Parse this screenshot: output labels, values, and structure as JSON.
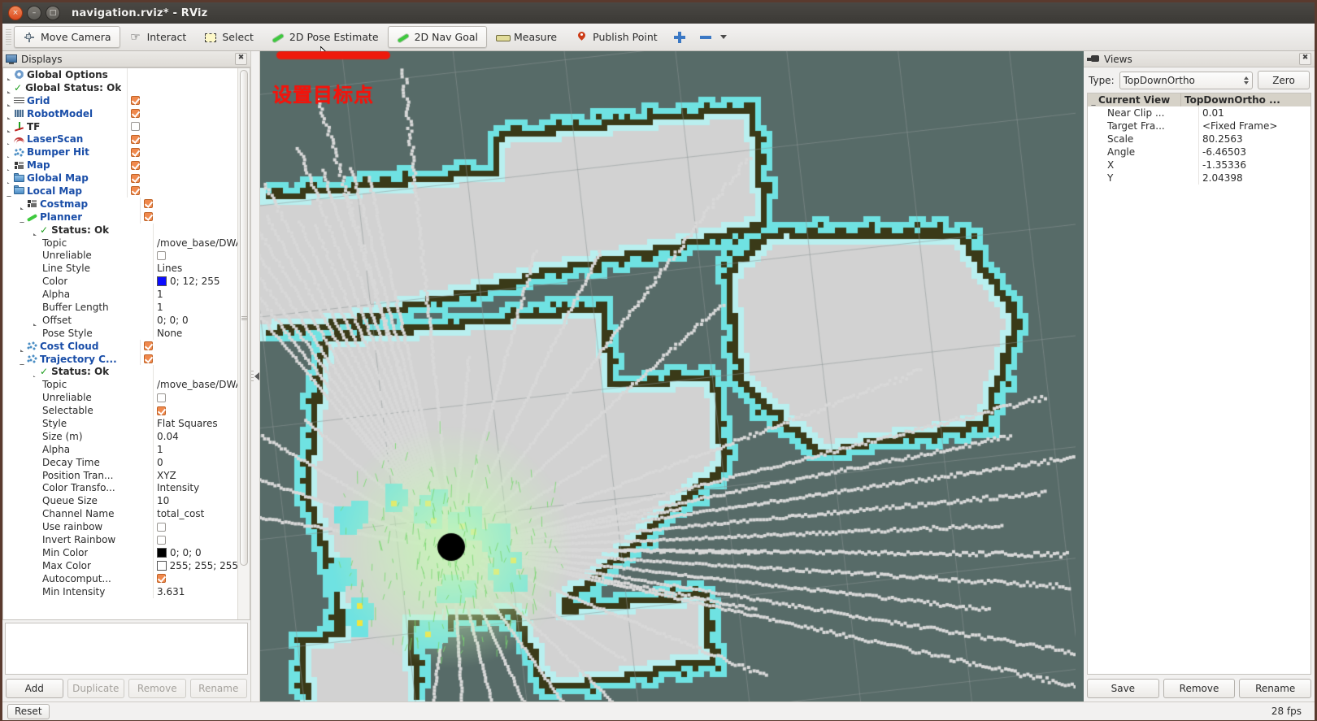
{
  "window": {
    "title": "navigation.rviz* - RViz",
    "close": "×",
    "minimize": "–",
    "maximize": "□"
  },
  "toolbar": {
    "items": [
      {
        "label": "Move Camera",
        "icon": "move-camera-icon",
        "active": true
      },
      {
        "label": "Interact",
        "icon": "hand-icon",
        "active": false
      },
      {
        "label": "Select",
        "icon": "select-rect-icon",
        "active": false
      },
      {
        "label": "2D Pose Estimate",
        "icon": "green-arrow-icon",
        "active": false
      },
      {
        "label": "2D Nav Goal",
        "icon": "green-arrow-icon",
        "active": true
      },
      {
        "label": "Measure",
        "icon": "ruler-icon",
        "active": false
      },
      {
        "label": "Publish Point",
        "icon": "map-pin-icon",
        "active": false
      }
    ],
    "add_tool_label": "",
    "remove_tool_label": ""
  },
  "displays_panel": {
    "title": "Displays",
    "close": "✖",
    "rows": [
      {
        "indent": 0,
        "twisty": "r",
        "icon": "mi-gear",
        "name": "Global Options",
        "style": "bold",
        "check": null,
        "value": ""
      },
      {
        "indent": 0,
        "twisty": "r",
        "icon": "tick",
        "name": "Global Status: Ok",
        "style": "bold",
        "check": null,
        "value": ""
      },
      {
        "indent": 0,
        "twisty": "r",
        "icon": "mi-grid",
        "name": "Grid",
        "style": "blue",
        "check": true,
        "value": ""
      },
      {
        "indent": 0,
        "twisty": "r",
        "icon": "mi-robot",
        "name": "RobotModel",
        "style": "blue",
        "check": true,
        "value": ""
      },
      {
        "indent": 0,
        "twisty": "r",
        "icon": "mi-tf",
        "name": "TF",
        "style": "bold",
        "check": false,
        "value": ""
      },
      {
        "indent": 0,
        "twisty": "r",
        "icon": "mi-laser",
        "name": "LaserScan",
        "style": "blue",
        "check": true,
        "value": ""
      },
      {
        "indent": 0,
        "twisty": "r",
        "icon": "mi-cloud",
        "name": "Bumper Hit",
        "style": "blue",
        "check": true,
        "value": ""
      },
      {
        "indent": 0,
        "twisty": "r",
        "icon": "mi-map",
        "name": "Map",
        "style": "blue",
        "check": true,
        "value": ""
      },
      {
        "indent": 0,
        "twisty": "r",
        "icon": "mi-folder",
        "name": "Global Map",
        "style": "blue",
        "check": true,
        "value": ""
      },
      {
        "indent": 0,
        "twisty": "d",
        "icon": "mi-folder",
        "name": "Local Map",
        "style": "blue",
        "check": true,
        "value": ""
      },
      {
        "indent": 1,
        "twisty": "r",
        "icon": "mi-map",
        "name": "Costmap",
        "style": "blue",
        "check": true,
        "value": ""
      },
      {
        "indent": 1,
        "twisty": "d",
        "icon": "mi-path",
        "name": "Planner",
        "style": "blue",
        "check": true,
        "value": ""
      },
      {
        "indent": 2,
        "twisty": "r",
        "icon": "tick",
        "name": "Status: Ok",
        "style": "bold",
        "check": null,
        "value": ""
      },
      {
        "indent": 2,
        "twisty": "none",
        "icon": "none",
        "name": "Topic",
        "style": "plain",
        "check": null,
        "value": "/move_base/DWAPlan..."
      },
      {
        "indent": 2,
        "twisty": "none",
        "icon": "none",
        "name": "Unreliable",
        "style": "plain",
        "check": false,
        "value": ""
      },
      {
        "indent": 2,
        "twisty": "none",
        "icon": "none",
        "name": "Line Style",
        "style": "plain",
        "check": null,
        "value": "Lines"
      },
      {
        "indent": 2,
        "twisty": "none",
        "icon": "none",
        "name": "Color",
        "style": "plain",
        "check": null,
        "value": "0; 12; 255",
        "swatch": "#0b0cff"
      },
      {
        "indent": 2,
        "twisty": "none",
        "icon": "none",
        "name": "Alpha",
        "style": "plain",
        "check": null,
        "value": "1"
      },
      {
        "indent": 2,
        "twisty": "none",
        "icon": "none",
        "name": "Buffer Length",
        "style": "plain",
        "check": null,
        "value": "1"
      },
      {
        "indent": 2,
        "twisty": "r",
        "icon": "none",
        "name": "Offset",
        "style": "plain",
        "check": null,
        "value": "0; 0; 0"
      },
      {
        "indent": 2,
        "twisty": "none",
        "icon": "none",
        "name": "Pose Style",
        "style": "plain",
        "check": null,
        "value": "None"
      },
      {
        "indent": 1,
        "twisty": "r",
        "icon": "mi-cloud",
        "name": "Cost Cloud",
        "style": "blue",
        "check": true,
        "value": ""
      },
      {
        "indent": 1,
        "twisty": "d",
        "icon": "mi-cloud",
        "name": "Trajectory C...",
        "style": "blue",
        "check": true,
        "value": ""
      },
      {
        "indent": 2,
        "twisty": "r",
        "icon": "tick",
        "name": "Status: Ok",
        "style": "bold",
        "check": null,
        "value": ""
      },
      {
        "indent": 2,
        "twisty": "none",
        "icon": "none",
        "name": "Topic",
        "style": "plain",
        "check": null,
        "value": "/move_base/DWAPlan..."
      },
      {
        "indent": 2,
        "twisty": "none",
        "icon": "none",
        "name": "Unreliable",
        "style": "plain",
        "check": false,
        "value": ""
      },
      {
        "indent": 2,
        "twisty": "none",
        "icon": "none",
        "name": "Selectable",
        "style": "plain",
        "check": true,
        "value": ""
      },
      {
        "indent": 2,
        "twisty": "none",
        "icon": "none",
        "name": "Style",
        "style": "plain",
        "check": null,
        "value": "Flat Squares"
      },
      {
        "indent": 2,
        "twisty": "none",
        "icon": "none",
        "name": "Size (m)",
        "style": "plain",
        "check": null,
        "value": "0.04"
      },
      {
        "indent": 2,
        "twisty": "none",
        "icon": "none",
        "name": "Alpha",
        "style": "plain",
        "check": null,
        "value": "1"
      },
      {
        "indent": 2,
        "twisty": "none",
        "icon": "none",
        "name": "Decay Time",
        "style": "plain",
        "check": null,
        "value": "0"
      },
      {
        "indent": 2,
        "twisty": "none",
        "icon": "none",
        "name": "Position Tran...",
        "style": "plain",
        "check": null,
        "value": "XYZ"
      },
      {
        "indent": 2,
        "twisty": "none",
        "icon": "none",
        "name": "Color Transfo...",
        "style": "plain",
        "check": null,
        "value": "Intensity"
      },
      {
        "indent": 2,
        "twisty": "none",
        "icon": "none",
        "name": "Queue Size",
        "style": "plain",
        "check": null,
        "value": "10"
      },
      {
        "indent": 2,
        "twisty": "none",
        "icon": "none",
        "name": "Channel Name",
        "style": "plain",
        "check": null,
        "value": "total_cost"
      },
      {
        "indent": 2,
        "twisty": "none",
        "icon": "none",
        "name": "Use rainbow",
        "style": "plain",
        "check": false,
        "value": ""
      },
      {
        "indent": 2,
        "twisty": "none",
        "icon": "none",
        "name": "Invert Rainbow",
        "style": "plain",
        "check": false,
        "value": ""
      },
      {
        "indent": 2,
        "twisty": "none",
        "icon": "none",
        "name": "Min Color",
        "style": "plain",
        "check": null,
        "value": "0; 0; 0",
        "swatch": "#000000"
      },
      {
        "indent": 2,
        "twisty": "none",
        "icon": "none",
        "name": "Max Color",
        "style": "plain",
        "check": null,
        "value": "255; 255; 255",
        "swatch": "#ffffff"
      },
      {
        "indent": 2,
        "twisty": "none",
        "icon": "none",
        "name": "Autocomput...",
        "style": "plain",
        "check": true,
        "value": ""
      },
      {
        "indent": 2,
        "twisty": "none",
        "icon": "none",
        "name": "Min Intensity",
        "style": "plain",
        "check": null,
        "value": "3.631"
      }
    ],
    "buttons": {
      "add": "Add",
      "duplicate": "Duplicate",
      "remove": "Remove",
      "rename": "Rename"
    }
  },
  "views_panel": {
    "title": "Views",
    "close": "✖",
    "type_label": "Type:",
    "type_value": "TopDownOrtho",
    "zero_label": "Zero",
    "rows": [
      {
        "name": "Current View",
        "value": "TopDownOrtho ...",
        "header": true,
        "twisty": "d"
      },
      {
        "name": "Near Clip ...",
        "value": "0.01",
        "header": false,
        "twisty": "none"
      },
      {
        "name": "Target Fra...",
        "value": "<Fixed Frame>",
        "header": false,
        "twisty": "none"
      },
      {
        "name": "Scale",
        "value": "80.2563",
        "header": false,
        "twisty": "none"
      },
      {
        "name": "Angle",
        "value": "-6.46503",
        "header": false,
        "twisty": "none"
      },
      {
        "name": "X",
        "value": "-1.35336",
        "header": false,
        "twisty": "none"
      },
      {
        "name": "Y",
        "value": "2.04398",
        "header": false,
        "twisty": "none"
      }
    ],
    "buttons": {
      "save": "Save",
      "remove": "Remove",
      "rename": "Rename"
    }
  },
  "viewport": {
    "annotation_text": "设置目标点",
    "annotation_color": "#f2140c",
    "background_color": "#576b68",
    "free_space_color": "#d2d2d2",
    "obstacle_color": "#3a3a18",
    "inflation_color": "#6fe2e2",
    "cost_cloud_color": "#c8f0b8",
    "robot_color": "#000000"
  },
  "statusbar": {
    "reset_label": "Reset",
    "fps": "28 fps"
  }
}
